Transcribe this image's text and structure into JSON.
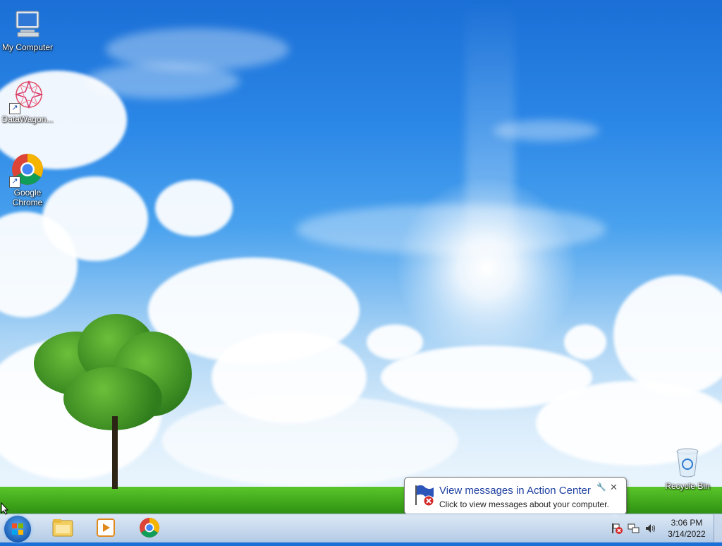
{
  "desktop": {
    "icons": [
      {
        "label": "My Computer",
        "icon": "computer-icon"
      },
      {
        "label": "DataWagon...",
        "icon": "datawagon-icon"
      },
      {
        "label": "Google Chrome",
        "icon": "chrome-icon"
      },
      {
        "label": "Recycle Bin",
        "icon": "recycle-bin-icon"
      }
    ]
  },
  "notification": {
    "title": "View messages in Action Center",
    "text": "Click to view messages about your computer.",
    "close_glyph": "✕",
    "pin_glyph": "🔧"
  },
  "taskbar": {
    "pinned": [
      {
        "icon": "file-explorer-icon"
      },
      {
        "icon": "media-player-icon"
      },
      {
        "icon": "chrome-icon"
      }
    ],
    "clock": {
      "time": "3:06 PM",
      "date": "3/14/2022"
    }
  },
  "colors": {
    "taskbar": "#c9dbef",
    "balloon_title": "#1d3fa0",
    "grass": "#3ea51a"
  }
}
